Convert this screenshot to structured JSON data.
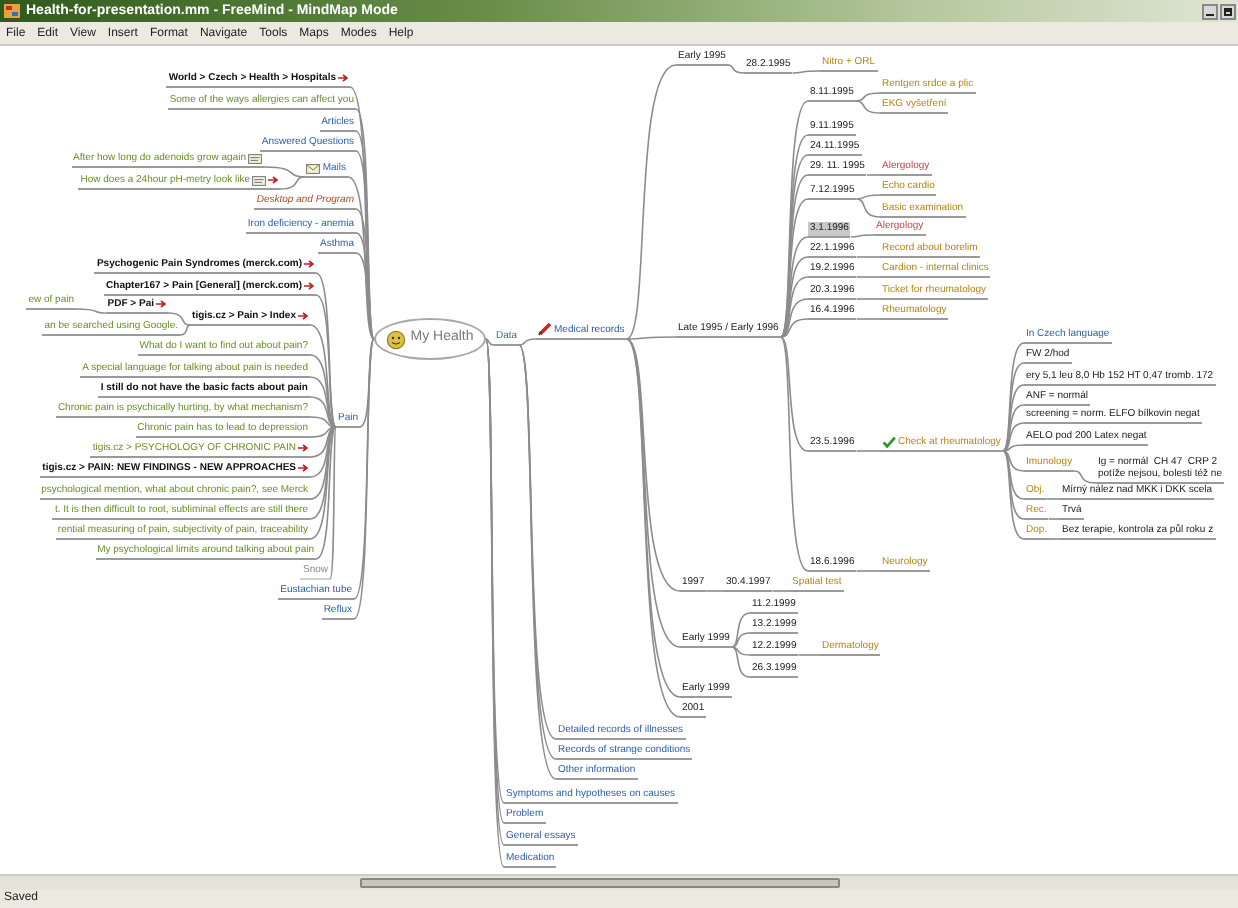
{
  "window": {
    "title": "Health-for-presentation.mm - FreeMind - MindMap Mode"
  },
  "menu": [
    "File",
    "Edit",
    "View",
    "Insert",
    "Format",
    "Navigate",
    "Tools",
    "Maps",
    "Modes",
    "Help"
  ],
  "map": {
    "root": {
      "text": "My Health"
    },
    "left": [
      {
        "text": "World > Czech > Health > Hospitals",
        "kind": "link",
        "selected": false,
        "link": true
      },
      {
        "text": "Some of the ways allergies can affect you",
        "kind": "note",
        "selected": false
      },
      {
        "text": "Articles",
        "kind": "topic",
        "selected": false
      },
      {
        "text": "Answered Questions",
        "kind": "topic",
        "selected": false
      },
      {
        "text": "Mails",
        "kind": "topic",
        "selected": false,
        "mail": true,
        "children": [
          {
            "text": "After how long do adenoids grow again",
            "kind": "note",
            "selected": false,
            "attachment": true
          },
          {
            "text": "How does a 24hour pH-metry look like",
            "kind": "note",
            "selected": false,
            "attachment": true,
            "link": true
          }
        ]
      },
      {
        "text": "Desktop and Program",
        "kind": "heading",
        "selected": false
      },
      {
        "text": "Iron deficiency - anemia",
        "kind": "topic",
        "selected": false
      },
      {
        "text": "Asthma",
        "kind": "topic",
        "selected": false
      },
      {
        "text": "Pain",
        "kind": "topic",
        "selected": false,
        "children": [
          {
            "text": "Psychogenic Pain Syndromes (merck.com)",
            "kind": "link",
            "selected": false,
            "link": true
          },
          {
            "text": "Chapter167 > Pain [General] (merck.com)",
            "kind": "link",
            "selected": false,
            "link": true
          },
          {
            "text": "tigis.cz > Pain > Index",
            "kind": "link",
            "selected": false,
            "link": true,
            "children": [
              {
                "text": "PDF > Pai",
                "kind": "link",
                "selected": false,
                "link": true,
                "children": [
                  {
                    "text": "ew of pain",
                    "kind": "note",
                    "selected": false
                  }
                ]
              },
              {
                "text": "an be searched using Google.",
                "kind": "note",
                "selected": false
              }
            ]
          },
          {
            "text": "What do I want to find out about pain?",
            "kind": "note",
            "selected": false
          },
          {
            "text": "A special language for talking about pain is needed",
            "kind": "note",
            "selected": false
          },
          {
            "text": "I still do not have the basic facts about pain",
            "kind": "link",
            "selected": false
          },
          {
            "text": "Chronic pain is psychically hurting, by what mechanism?",
            "kind": "note",
            "selected": false
          },
          {
            "text": "Chronic pain has to lead to depression",
            "kind": "note",
            "selected": false
          },
          {
            "text": "tigis.cz > PSYCHOLOGY OF CHRONIC PAIN",
            "kind": "note",
            "selected": false,
            "link": true
          },
          {
            "text": "tigis.cz > PAIN: NEW FINDINGS - NEW APPROACHES",
            "kind": "link",
            "selected": false,
            "link": true
          },
          {
            "text": "psychological mention, what about chronic pain?, see Merck",
            "kind": "note",
            "selected": false
          },
          {
            "text": "t. It is then difficult to root, subliminal effects are still there",
            "kind": "note",
            "selected": false
          },
          {
            "text": "rential measuring of pain, subjectivity of pain, traceability",
            "kind": "note",
            "selected": false
          },
          {
            "text": "My psychological limits around talking about pain",
            "kind": "note",
            "selected": false
          },
          {
            "text": "Snow",
            "kind": "faint",
            "selected": false
          }
        ]
      },
      {
        "text": "Eustachian tube",
        "kind": "topic",
        "selected": false
      },
      {
        "text": "Reflux",
        "kind": "topic",
        "selected": false
      }
    ],
    "right": [
      {
        "text": "Data",
        "kind": "branch",
        "selected": false,
        "children": [
          {
            "text": "Medical records",
            "kind": "topic",
            "selected": false,
            "pencil": true,
            "children": [
              {
                "text": "Early 1995",
                "kind": "date",
                "selected": false,
                "children": [
                  {
                    "text": "28.2.1995",
                    "kind": "date",
                    "selected": false,
                    "children": [
                      {
                        "text": "Nitro + ORL",
                        "kind": "finding",
                        "selected": false
                      }
                    ]
                  }
                ]
              },
              {
                "text": "Late 1995 / Early 1996",
                "kind": "date",
                "selected": false,
                "children": [
                  {
                    "text": "8.11.1995",
                    "kind": "date",
                    "selected": false,
                    "children": [
                      {
                        "text": "Rentgen srdce a plic",
                        "kind": "finding",
                        "selected": false
                      },
                      {
                        "text": "EKG vyšetření",
                        "kind": "finding",
                        "selected": false
                      }
                    ]
                  },
                  {
                    "text": "9.11.1995",
                    "kind": "date",
                    "selected": false
                  },
                  {
                    "text": "24.11.1995",
                    "kind": "date",
                    "selected": false
                  },
                  {
                    "text": "29. 11. 1995",
                    "kind": "date",
                    "selected": false,
                    "children": [
                      {
                        "text": "Alergology",
                        "kind": "alert",
                        "selected": false
                      }
                    ]
                  },
                  {
                    "text": "7.12.1995",
                    "kind": "date",
                    "selected": false,
                    "children": [
                      {
                        "text": "Echo cardio",
                        "kind": "finding",
                        "selected": false
                      },
                      {
                        "text": "Basic examination",
                        "kind": "finding",
                        "selected": false
                      }
                    ]
                  },
                  {
                    "text": "3.1.1996",
                    "kind": "date",
                    "selected": true,
                    "children": [
                      {
                        "text": "Alergology",
                        "kind": "alert",
                        "selected": false
                      }
                    ]
                  },
                  {
                    "text": "22.1.1996",
                    "kind": "date",
                    "selected": false,
                    "children": [
                      {
                        "text": "Record about borelim",
                        "kind": "finding",
                        "selected": false
                      }
                    ]
                  },
                  {
                    "text": "19.2.1996",
                    "kind": "date",
                    "selected": false,
                    "children": [
                      {
                        "text": "Cardion - internal clinics",
                        "kind": "finding",
                        "selected": false
                      }
                    ]
                  },
                  {
                    "text": "20.3.1996",
                    "kind": "date",
                    "selected": false,
                    "children": [
                      {
                        "text": "Ticket for rheumatology",
                        "kind": "finding",
                        "selected": false
                      }
                    ]
                  },
                  {
                    "text": "16.4.1996",
                    "kind": "date",
                    "selected": false,
                    "children": [
                      {
                        "text": "Rheumatology",
                        "kind": "finding",
                        "selected": false
                      }
                    ]
                  },
                  {
                    "text": "23.5.1996",
                    "kind": "date",
                    "selected": false,
                    "children": [
                      {
                        "text": "Check at rheumatology",
                        "kind": "finding",
                        "selected": false,
                        "check": true,
                        "children": [
                          {
                            "text": "In Czech language",
                            "kind": "topic",
                            "selected": false
                          },
                          {
                            "text": "FW 2/hod",
                            "kind": "date",
                            "selected": false
                          },
                          {
                            "text": "ery 5,1 leu 8,0 Hb 152 HT 0,47 tromb. 172",
                            "kind": "date",
                            "selected": false
                          },
                          {
                            "text": "ANF = normál",
                            "kind": "date",
                            "selected": false
                          },
                          {
                            "text": "screening = norm. ELFO bílkovin negat",
                            "kind": "date",
                            "selected": false
                          },
                          {
                            "text": "AELO pod 200 Latex negat",
                            "kind": "date",
                            "selected": false
                          },
                          {
                            "text": "Imunology",
                            "kind": "finding",
                            "selected": false,
                            "children": [
                              {
                                "text": "Ig = normál  CH 47  CRP 2\npotíže nejsou, bolesti též ne",
                                "kind": "date",
                                "selected": false
                              }
                            ]
                          },
                          {
                            "text": "Obj.",
                            "kind": "finding",
                            "selected": false,
                            "children": [
                              {
                                "text": "Mírný nález nad MKK i DKK scela",
                                "kind": "date",
                                "selected": false
                              }
                            ]
                          },
                          {
                            "text": "Rec.",
                            "kind": "finding",
                            "selected": false,
                            "children": [
                              {
                                "text": "Trvá",
                                "kind": "date",
                                "selected": false
                              }
                            ]
                          },
                          {
                            "text": "Dop.",
                            "kind": "finding",
                            "selected": false,
                            "children": [
                              {
                                "text": "Bez terapie, kontrola za půl roku z",
                                "kind": "date",
                                "selected": false
                              }
                            ]
                          }
                        ]
                      }
                    ]
                  },
                  {
                    "text": "18.6.1996",
                    "kind": "date",
                    "selected": false,
                    "children": [
                      {
                        "text": "Neurology",
                        "kind": "finding",
                        "selected": false
                      }
                    ]
                  }
                ]
              },
              {
                "text": "1997",
                "kind": "date",
                "selected": false,
                "children": [
                  {
                    "text": "30.4.1997",
                    "kind": "date",
                    "selected": false,
                    "children": [
                      {
                        "text": "Spatial test",
                        "kind": "finding",
                        "selected": false
                      }
                    ]
                  }
                ]
              },
              {
                "text": "Early 1999",
                "kind": "date",
                "selected": false,
                "children": [
                  {
                    "text": "11.2.1999",
                    "kind": "date",
                    "selected": false
                  },
                  {
                    "text": "13.2.1999",
                    "kind": "date",
                    "selected": false
                  },
                  {
                    "text": "12.2.1999",
                    "kind": "date",
                    "selected": false,
                    "children": [
                      {
                        "text": "Dermatology",
                        "kind": "finding",
                        "selected": false
                      }
                    ]
                  },
                  {
                    "text": "26.3.1999",
                    "kind": "date",
                    "selected": false
                  }
                ]
              },
              {
                "text": "Early 1999",
                "kind": "date",
                "selected": false
              },
              {
                "text": "2001",
                "kind": "date",
                "selected": false
              }
            ]
          },
          {
            "text": "Detailed records of illnesses",
            "kind": "topic",
            "selected": false
          },
          {
            "text": "Records of strange conditions",
            "kind": "topic",
            "selected": false
          },
          {
            "text": "Other information",
            "kind": "topic",
            "selected": false
          }
        ]
      },
      {
        "text": "Symptoms and hypotheses on causes",
        "kind": "topic",
        "selected": false
      },
      {
        "text": "Problem",
        "kind": "topic",
        "selected": false
      },
      {
        "text": "General essays",
        "kind": "topic",
        "selected": false
      },
      {
        "text": "Medication",
        "kind": "topic",
        "selected": false
      }
    ]
  },
  "status_bar": "Saved"
}
